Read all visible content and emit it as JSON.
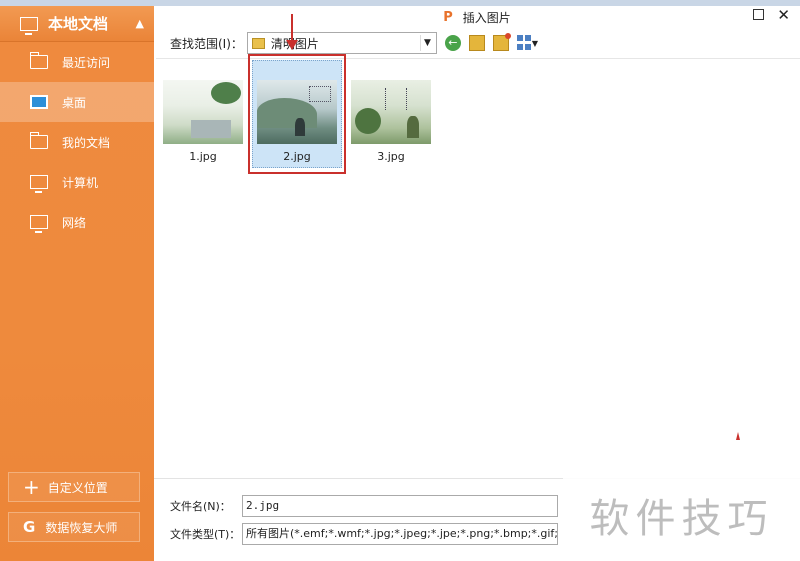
{
  "sidebar": {
    "title": "本地文档",
    "items": [
      {
        "label": "最近访问",
        "icon": "recent-folder-icon"
      },
      {
        "label": "桌面",
        "icon": "desktop-icon",
        "active": true
      },
      {
        "label": "我的文档",
        "icon": "folder-icon"
      },
      {
        "label": "计算机",
        "icon": "computer-icon"
      },
      {
        "label": "网络",
        "icon": "network-icon"
      }
    ],
    "custom_location": "自定义位置",
    "data_recovery": "数据恢复大师"
  },
  "dialog": {
    "title": "插入图片",
    "look_in_label": "查找范围(I)：",
    "look_in_value": "清明图片"
  },
  "files": [
    {
      "name": "1.jpg",
      "selected": false
    },
    {
      "name": "2.jpg",
      "selected": true
    },
    {
      "name": "3.jpg",
      "selected": false
    }
  ],
  "bottom": {
    "filename_label": "文件名(N)：",
    "filename_value": "2.jpg",
    "filetype_label": "文件类型(T)：",
    "filetype_value": "所有图片(*.emf;*.wmf;*.jpg;*.jpeg;*.jpe;*.png;*.bmp;*.gif;*.tif;*.tiff;*."
  },
  "watermark": "软件技巧",
  "colors": {
    "sidebar": "#ef8a3e",
    "selection": "#cde4f7",
    "annotation": "#c9302c"
  }
}
